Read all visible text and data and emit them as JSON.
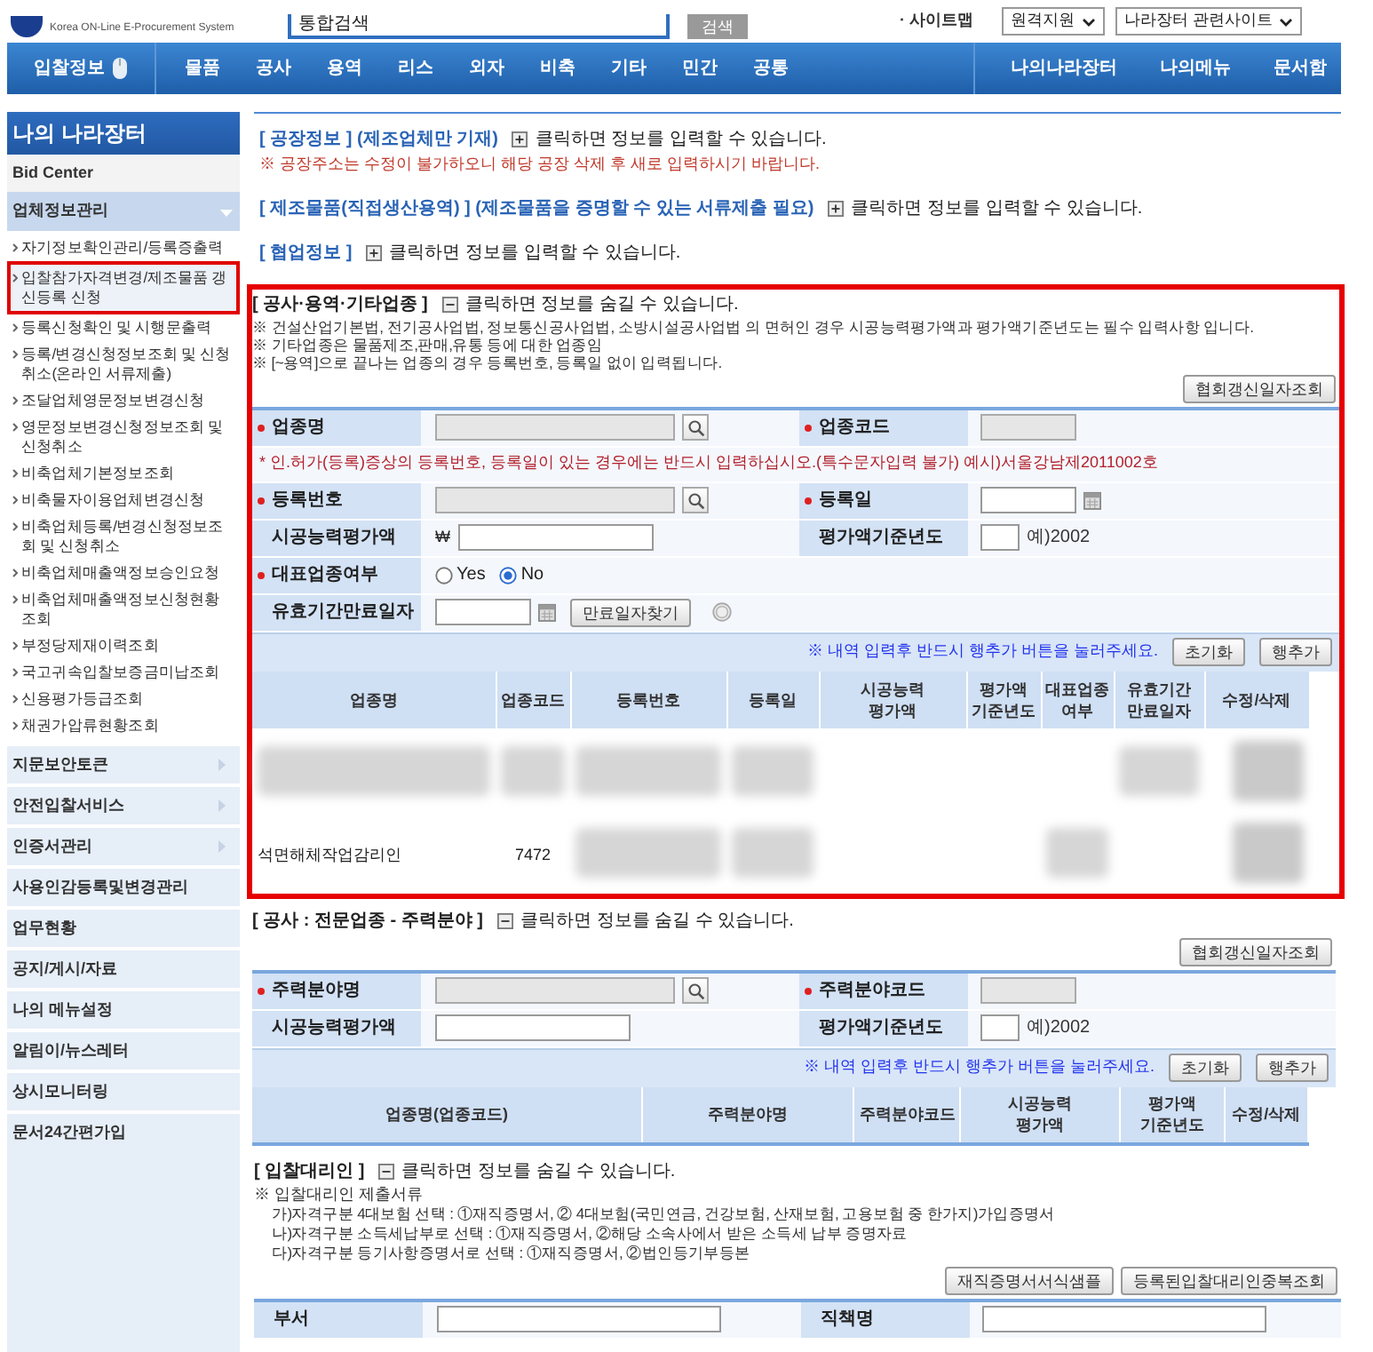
{
  "header": {
    "logo_subtitle": "Korea ON-Line E-Procurement System",
    "search_value": "통합검색",
    "search_button": "검색",
    "sitemap": "· 사이트맵",
    "selects": [
      "원격지원",
      "나라장터 관련사이트"
    ]
  },
  "nav": {
    "first": "입찰정보",
    "items": [
      "물품",
      "공사",
      "용역",
      "리스",
      "외자",
      "비축",
      "기타",
      "민간",
      "공통"
    ],
    "right": [
      "나의나라장터",
      "나의메뉴",
      "문서함"
    ]
  },
  "sidebar": {
    "title": "나의 나라장터",
    "subtitle": "Bid Center",
    "groups": [
      {
        "label": "업체정보관리",
        "kind": "expandable",
        "expanded": true,
        "children": [
          {
            "label": "자기정보확인관리/등록증출력",
            "selected": false
          },
          {
            "label": "입찰참가자격변경/제조물품 갱신등록 신청",
            "selected": true
          },
          {
            "label": "등록신청확인 및 시행문출력",
            "selected": false
          },
          {
            "label": "등록/변경신청정보조회 및 신청취소(온라인 서류제출)",
            "selected": false
          },
          {
            "label": "조달업체영문정보변경신청",
            "selected": false
          },
          {
            "label": "영문정보변경신청정보조회 및 신청취소",
            "selected": false
          },
          {
            "label": "비축업체기본정보조회",
            "selected": false
          },
          {
            "label": "비축물자이용업체변경신청",
            "selected": false
          },
          {
            "label": "비축업체등록/변경신청정보조회 및 신청취소",
            "selected": false
          },
          {
            "label": "비축업체매출액정보승인요청",
            "selected": false
          },
          {
            "label": "비축업체매출액정보신청현황 조회",
            "selected": false
          },
          {
            "label": "부정당제재이력조회",
            "selected": false
          },
          {
            "label": "국고귀속입찰보증금미납조회",
            "selected": false
          },
          {
            "label": "신용평가등급조회",
            "selected": false
          },
          {
            "label": "채권가압류현황조회",
            "selected": false
          }
        ]
      },
      {
        "label": "지문보안토큰",
        "kind": "submenu"
      },
      {
        "label": "안전입찰서비스",
        "kind": "submenu"
      },
      {
        "label": "인증서관리",
        "kind": "submenu"
      },
      {
        "label": "사용인감등록및변경관리",
        "kind": "link"
      },
      {
        "label": "업무현황",
        "kind": "link"
      },
      {
        "label": "공지/게시/자료",
        "kind": "link"
      },
      {
        "label": "나의 메뉴설정",
        "kind": "link"
      },
      {
        "label": "알림이/뉴스레터",
        "kind": "link"
      },
      {
        "label": "상시모니터링",
        "kind": "link"
      },
      {
        "label": "문서24간편가입",
        "kind": "link"
      }
    ]
  },
  "collapsed_sections": [
    {
      "title": "[ 공장정보 ]",
      "note": "(제조업체만 기재)",
      "expanded": false,
      "toggle": "클릭하면 정보를 입력할 수 있습니다.",
      "warning": "※ 공장주소는 수정이 불가하오니 해당 공장 삭제 후 새로 입력하시기 바랍니다."
    },
    {
      "title": "[ 제조물품(직접생산용역) ]",
      "note": "(제조물품을 증명할 수 있는 서류제출 필요)",
      "expanded": false,
      "toggle": "클릭하면 정보를 입력할 수 있습니다."
    },
    {
      "title": "[ 협업정보 ]",
      "expanded": false,
      "toggle": "클릭하면 정보를 입력할 수 있습니다."
    }
  ],
  "industry_section": {
    "title": "[ 공사·용역·기타업종 ]",
    "highlighted": true,
    "expanded": true,
    "toggle": "클릭하면 정보를 숨길 수 있습니다.",
    "notes": [
      "※ 건설산업기본법, 전기공사업법, 정보통신공사업법, 소방시설공사업법 의 면허인 경우 시공능력평가액과 평가액기준년도는 필수 입력사항 입니다.",
      "※ 기타업종은 물품제조,판매,유통 등에 대한 업종임",
      "※ [~용역]으로 끝나는 업종의 경우 등록번호, 등록일 없이 입력됩니다."
    ],
    "lookup_button": "협회갱신일자조회",
    "rows": [
      {
        "kind": "pair",
        "fields": [
          {
            "label": "업종명",
            "required": true,
            "kind": "lookup"
          },
          {
            "label": "업종코드",
            "required": true,
            "kind": "readonly"
          }
        ]
      },
      {
        "kind": "notice",
        "text": "* 인.허가(등록)증상의 등록번호, 등록일이 있는 경우에는 반드시 입력하십시오.(특수문자입력 불가) 예시)서울강남제2011002호"
      },
      {
        "kind": "pair",
        "fields": [
          {
            "label": "등록번호",
            "required": true,
            "kind": "lookup"
          },
          {
            "label": "등록일",
            "required": true,
            "kind": "date"
          }
        ]
      },
      {
        "kind": "pair",
        "fields": [
          {
            "label": "시공능력평가액",
            "required": false,
            "kind": "won",
            "currency": "₩"
          },
          {
            "label": "평가액기준년도",
            "required": false,
            "kind": "year",
            "hint": "예)2002"
          }
        ]
      },
      {
        "kind": "single",
        "fields": [
          {
            "label": "대표업종여부",
            "required": true,
            "kind": "radio",
            "options": [
              {
                "label": "Yes",
                "selected": false
              },
              {
                "label": "No",
                "selected": true
              }
            ]
          }
        ]
      },
      {
        "kind": "single",
        "fields": [
          {
            "label": "유효기간만료일자",
            "required": false,
            "kind": "expiry",
            "button": "만료일자찾기"
          }
        ]
      }
    ],
    "hint": "※ 내역 입력후 반드시 행추가 버튼을 눌러주세요.",
    "actions": [
      "초기화",
      "행추가"
    ],
    "columns": [
      "업종명",
      "업종코드",
      "등록번호",
      "등록일",
      "시공능력\n평가액",
      "평가액\n기준년도",
      "대표업종\n여부",
      "유효기간\n만료일자",
      "수정/삭제"
    ],
    "table_rows": [
      {
        "cells": [
          {
            "kind": "redacted"
          },
          {
            "kind": "redacted"
          },
          {
            "kind": "redacted"
          },
          {
            "kind": "redacted"
          },
          {
            "kind": "empty"
          },
          {
            "kind": "empty"
          },
          {
            "kind": "empty"
          },
          {
            "kind": "redacted"
          },
          {
            "kind": "redacted"
          }
        ]
      },
      {
        "cells": [
          {
            "kind": "text",
            "text": "석면해체작업감리인"
          },
          {
            "kind": "text",
            "text": "7472"
          },
          {
            "kind": "redacted"
          },
          {
            "kind": "redacted"
          },
          {
            "kind": "empty"
          },
          {
            "kind": "empty"
          },
          {
            "kind": "redacted"
          },
          {
            "kind": "empty"
          },
          {
            "kind": "redacted"
          }
        ]
      }
    ]
  },
  "field_section": {
    "title": "[ 공사 : 전문업종 - 주력분야 ]",
    "highlighted": false,
    "expanded": true,
    "toggle": "클릭하면 정보를 숨길 수 있습니다.",
    "lookup_button": "협회갱신일자조회",
    "rows": [
      {
        "kind": "pair",
        "fields": [
          {
            "label": "주력분야명",
            "required": true,
            "kind": "lookup"
          },
          {
            "label": "주력분야코드",
            "required": true,
            "kind": "readonly"
          }
        ]
      },
      {
        "kind": "pair",
        "fields": [
          {
            "label": "시공능력평가액",
            "required": false,
            "kind": "text"
          },
          {
            "label": "평가액기준년도",
            "required": false,
            "kind": "year",
            "hint": "예)2002"
          }
        ]
      }
    ],
    "hint": "※ 내역 입력후 반드시 행추가 버튼을 눌러주세요.",
    "actions": [
      "초기화",
      "행추가"
    ],
    "columns": [
      "업종명(업종코드)",
      "주력분야명",
      "주력분야코드",
      "시공능력\n평가액",
      "평가액\n기준년도",
      "수정/삭제"
    ]
  },
  "agent_section": {
    "title": "[ 입찰대리인 ]",
    "expanded": true,
    "toggle": "클릭하면 정보를 숨길 수 있습니다.",
    "notes": [
      "※ 입찰대리인 제출서류"
    ],
    "sub_notes": [
      "가)자격구분 4대보험 선택 : ①재직증명서, ② 4대보험(국민연금, 건강보험, 산재보험, 고용보험 중 한가지)가입증명서",
      "나)자격구분 소득세납부로 선택 : ①재직증명서, ②해당 소속사에서 받은 소득세 납부 증명자료",
      "다)자격구분 등기사항증명서로 선택 : ①재직증명서, ②법인등기부등본"
    ],
    "buttons": [
      "재직증명서서식샘플",
      "등록된입찰대리인중복조회"
    ],
    "rows": [
      {
        "kind": "pair",
        "fields": [
          {
            "label": "부서",
            "required": false,
            "kind": "wide"
          },
          {
            "label": "직책명",
            "required": false,
            "kind": "wide"
          }
        ]
      }
    ]
  }
}
